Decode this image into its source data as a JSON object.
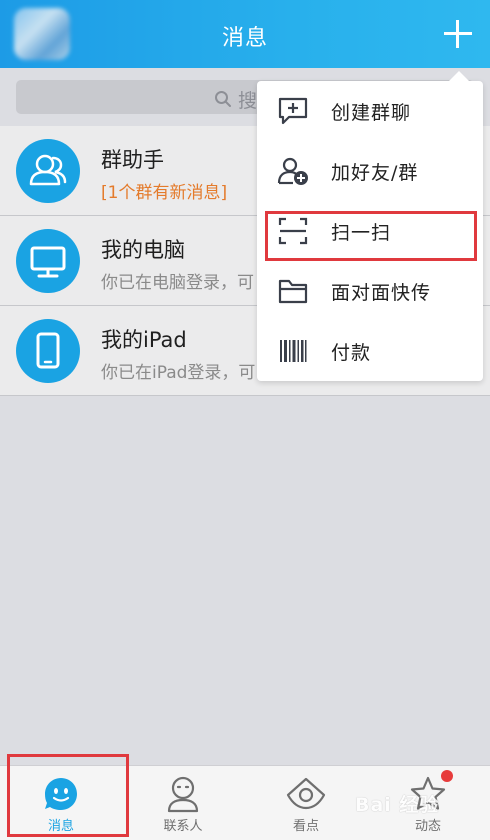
{
  "header": {
    "title": "消息"
  },
  "search": {
    "placeholder": "搜"
  },
  "conversations": [
    {
      "title": "群助手",
      "subtitle": "[1个群有新消息]",
      "icon": "group-assistant-icon"
    },
    {
      "title": "我的电脑",
      "subtitle": "你已在电脑登录，可",
      "icon": "computer-icon"
    },
    {
      "title": "我的iPad",
      "subtitle": "你已在iPad登录，可",
      "icon": "ipad-icon"
    }
  ],
  "menu": {
    "items": [
      {
        "label": "创建群聊",
        "icon": "create-group-chat-icon"
      },
      {
        "label": "加好友/群",
        "icon": "add-friend-icon"
      },
      {
        "label": "扫一扫",
        "icon": "scan-icon"
      },
      {
        "label": "面对面快传",
        "icon": "folder-icon"
      },
      {
        "label": "付款",
        "icon": "barcode-icon"
      }
    ]
  },
  "tabs": [
    {
      "label": "消息",
      "icon": "message-face-icon",
      "active": true
    },
    {
      "label": "联系人",
      "icon": "contacts-icon",
      "active": false
    },
    {
      "label": "看点",
      "icon": "eye-icon",
      "active": false
    },
    {
      "label": "动态",
      "icon": "star-icon",
      "active": false
    }
  ],
  "watermark": "Bai 经验",
  "colors": {
    "header_start": "#1d9be6",
    "header_end": "#2fb8ef",
    "accent": "#1aa3e3",
    "highlight_border": "#e0393e",
    "notice_text": "#e47b2c",
    "badge": "#e73c3c"
  }
}
